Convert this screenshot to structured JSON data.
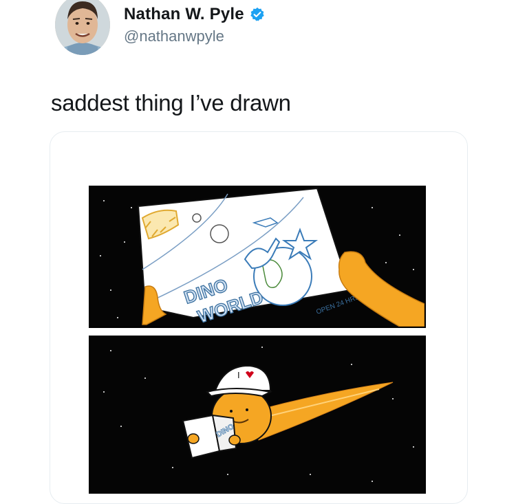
{
  "tweet": {
    "author_name": "Nathan W. Pyle",
    "handle": "@nathanwpyle",
    "verified_icon": "verified-badge-icon",
    "text": "saddest thing I’ve drawn"
  },
  "comic": {
    "panel1": {
      "brochure_title_line1": "DINO",
      "brochure_title_line2": "WORLD",
      "open_hours": "OPEN 24 HRS"
    },
    "panel2": {
      "cap_text": "I",
      "mini_brochure_text": "DINO"
    }
  },
  "colors": {
    "verified_blue": "#1da1f2",
    "comet_orange": "#f5a623",
    "space_black": "#050505"
  }
}
